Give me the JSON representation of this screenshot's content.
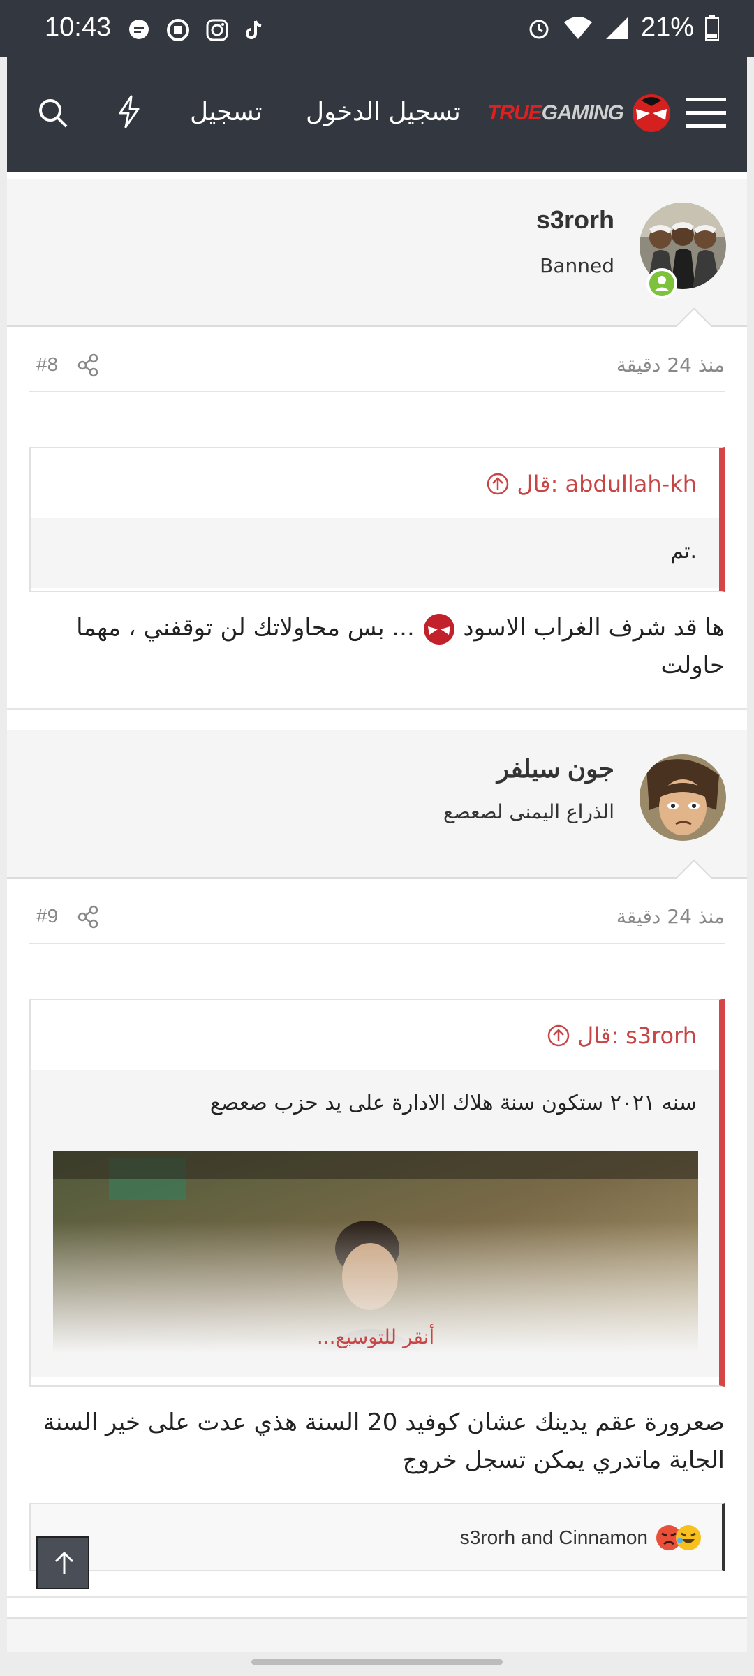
{
  "status_bar": {
    "time": "10:43",
    "battery": "21%"
  },
  "header": {
    "logo_text": "TRUEGAMING",
    "login_label": "تسجيل الدخول",
    "register_label": "تسجيل"
  },
  "posts": [
    {
      "username": "s3rorh",
      "user_title": "Banned",
      "time": "منذ 24 دقيقة",
      "number": "#8",
      "quote_author": "abdullah-kh",
      "quote_said": "قال:",
      "quote_text": "تم.",
      "text_line1": "ها قد شرف الغراب الاسود",
      "text_line1b": "... بس محاولاتك لن توقفني ، مهما",
      "text_line2": "حاولت"
    },
    {
      "username": "جون سيلفر",
      "user_title": "الذراع اليمنى لصعصع",
      "time": "منذ 24 دقيقة",
      "number": "#9",
      "quote_author": "s3rorh",
      "quote_said": "قال:",
      "quote_text": "سنه ٢٠٢١ ستكون سنة هلاك الادارة على يد حزب صعصع",
      "expand_label": "أنقر للتوسيع...",
      "text_line1": "صعرورة عقم يدينك عشان كوفيد 20 السنة هذي عدت على خير السنة",
      "text_line2": "الجاية ماتدري يمكن تسجل خروج",
      "reactions_text": "s3rorh and Cinnamon"
    }
  ],
  "colors": {
    "header_bg": "#33373f",
    "accent_red": "#d64545",
    "online_green": "#7cc23a"
  }
}
